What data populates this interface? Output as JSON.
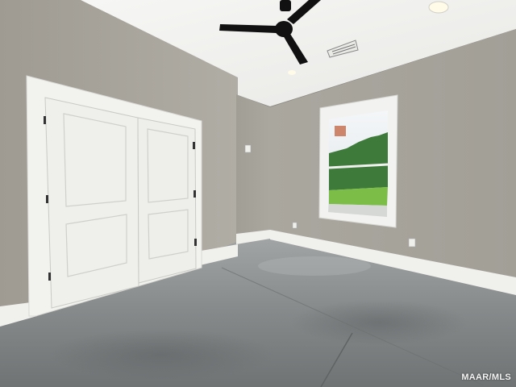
{
  "scene": {
    "description_hidden": false,
    "watermark": "MAAR/MLS",
    "colors": {
      "ceiling": "#f3f3f1",
      "wall_left": "#a8a59d",
      "wall_back": "#a5a29a",
      "wall_right": "#a7a49c",
      "trim": "#f1f1ee",
      "door": "#efefec",
      "floor": "#7c7f80",
      "fan": "#111111",
      "window_sky": "#e9eef2",
      "window_grass": "#7fc04a",
      "window_trees": "#3f7f3a"
    },
    "objects": {
      "ceiling_fan": "ceiling-fan-icon",
      "air_vent": "air-vent-icon",
      "light_switch": "light-switch-icon",
      "outlet": "outlet-icon"
    }
  }
}
